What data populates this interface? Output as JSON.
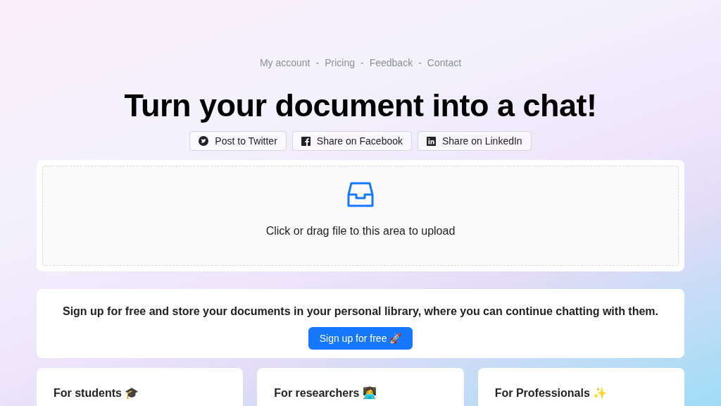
{
  "nav": {
    "links": [
      "My account",
      "Pricing",
      "Feedback",
      "Contact"
    ],
    "separator": "-"
  },
  "title": "Turn your document into a chat!",
  "share_buttons": [
    {
      "kind": "twitter",
      "label": "Post to Twitter"
    },
    {
      "kind": "facebook",
      "label": "Share on Facebook"
    },
    {
      "kind": "linkedin",
      "label": "Share on LinkedIn"
    }
  ],
  "upload": {
    "text": "Click or drag file to this area to upload"
  },
  "signup": {
    "text": "Sign up for free and store your documents in your personal library, where you can continue chatting with them.",
    "button": "Sign up for free 🚀"
  },
  "cards": [
    {
      "title": "For students 🎓"
    },
    {
      "title": "For researchers 👩‍💻"
    },
    {
      "title": "For Professionals ✨"
    }
  ]
}
